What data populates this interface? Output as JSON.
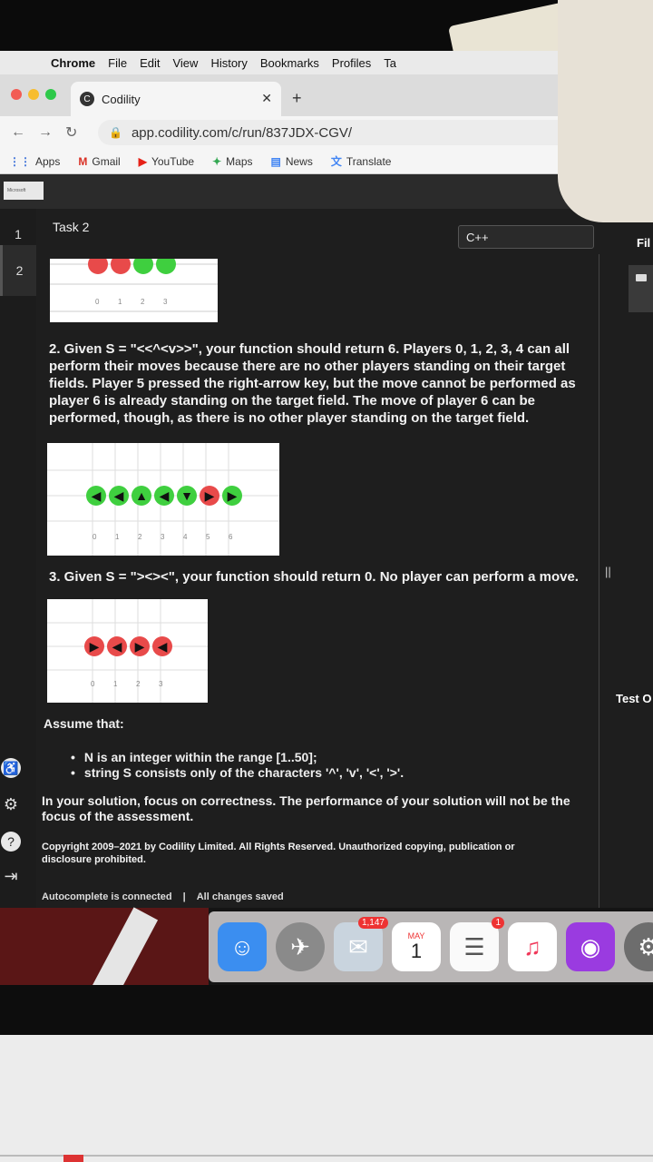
{
  "menubar": {
    "app": "Chrome",
    "items": [
      "File",
      "Edit",
      "View",
      "History",
      "Bookmarks",
      "Profiles",
      "Ta"
    ]
  },
  "browser": {
    "tab_title": "Codility",
    "url": "app.codility.com/c/run/837JDX-CGV/",
    "bookmarks": [
      {
        "label": "Apps",
        "icon": "apps-grid-icon"
      },
      {
        "label": "Gmail",
        "icon": "gmail-icon"
      },
      {
        "label": "YouTube",
        "icon": "youtube-icon"
      },
      {
        "label": "Maps",
        "icon": "maps-icon"
      },
      {
        "label": "News",
        "icon": "news-icon"
      },
      {
        "label": "Translate",
        "icon": "translate-icon"
      }
    ],
    "ms_label": "Microsoft"
  },
  "sidebar": {
    "numbers": [
      "1",
      "2"
    ]
  },
  "task": {
    "title": "Task 2",
    "language": "C++",
    "files_label": "Fil",
    "test_label": "Test O",
    "example2": "2. Given S = \"<<^<v>>\", your function should return 6. Players 0, 1, 2, 3, 4 can all perform their moves because there are no other players standing on their target fields. Player 5 pressed the right-arrow key, but the move cannot be performed as player 6 is already standing on the target field. The move of player 6 can be performed, though, as there is no other player standing on the target field.",
    "example3": "3. Given S = \"><><\", your function should return 0. No player can perform a move.",
    "assume_heading": "Assume that:",
    "assumptions": [
      "N is an integer within the range [1..50];",
      "string S consists only of the characters '^', 'v', '<', '>'."
    ],
    "focus": "In your solution, focus on correctness. The performance of your solution will not be the focus of the assessment.",
    "copyright": "Copyright 2009–2021 by Codility Limited. All Rights Reserved. Unauthorized copying, publication or disclosure prohibited.",
    "status_autocomplete": "Autocomplete is connected",
    "status_saved": "All changes saved"
  },
  "figures": {
    "fig1_ticks": [
      "0",
      "1",
      "2",
      "3"
    ],
    "fig2_ticks": [
      "0",
      "1",
      "2",
      "3",
      "4",
      "5",
      "6"
    ],
    "fig3_ticks": [
      "0",
      "1",
      "2",
      "3"
    ]
  },
  "dock": {
    "mail_badge": "1,147",
    "calendar_month": "MAY",
    "calendar_day": "1",
    "reminders_badge": "1"
  },
  "colors": {
    "green": "#3fcf3f",
    "red": "#e84a4a",
    "editor_bg": "#1e1e1e"
  }
}
